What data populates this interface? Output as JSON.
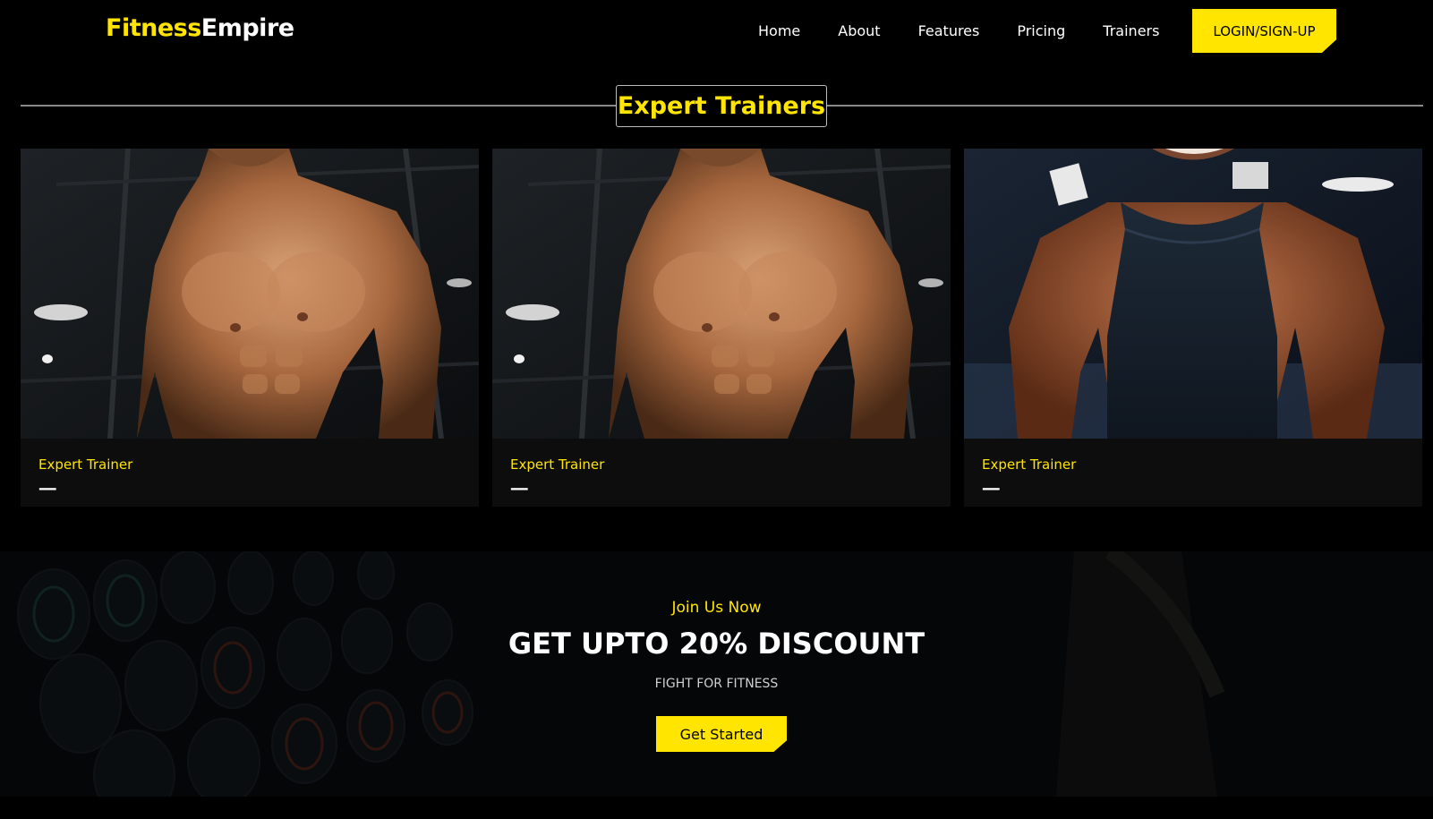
{
  "brand": {
    "part1": "Fitness",
    "part2": "Empire",
    "accent_color": "#ffe500"
  },
  "nav": {
    "links": [
      "Home",
      "About",
      "Features",
      "Pricing",
      "Trainers"
    ],
    "login_label": "LOGIN/SIGN-UP"
  },
  "trainers_section": {
    "title": "Expert Trainers",
    "cards": [
      {
        "role": "Expert Trainer",
        "name": "----",
        "photo": "shirtless-muscular-man-gym"
      },
      {
        "role": "Expert Trainer",
        "name": "----",
        "photo": "shirtless-muscular-man-gym"
      },
      {
        "role": "Expert Trainer",
        "name": "----",
        "photo": "muscular-man-black-tank-top-gym"
      }
    ]
  },
  "join_section": {
    "kicker": "Join Us Now",
    "headline": "GET UPTO 20% DISCOUNT",
    "subline": "FIGHT FOR FITNESS",
    "cta_label": "Get Started",
    "background": "dumbbell-rack-dark"
  }
}
